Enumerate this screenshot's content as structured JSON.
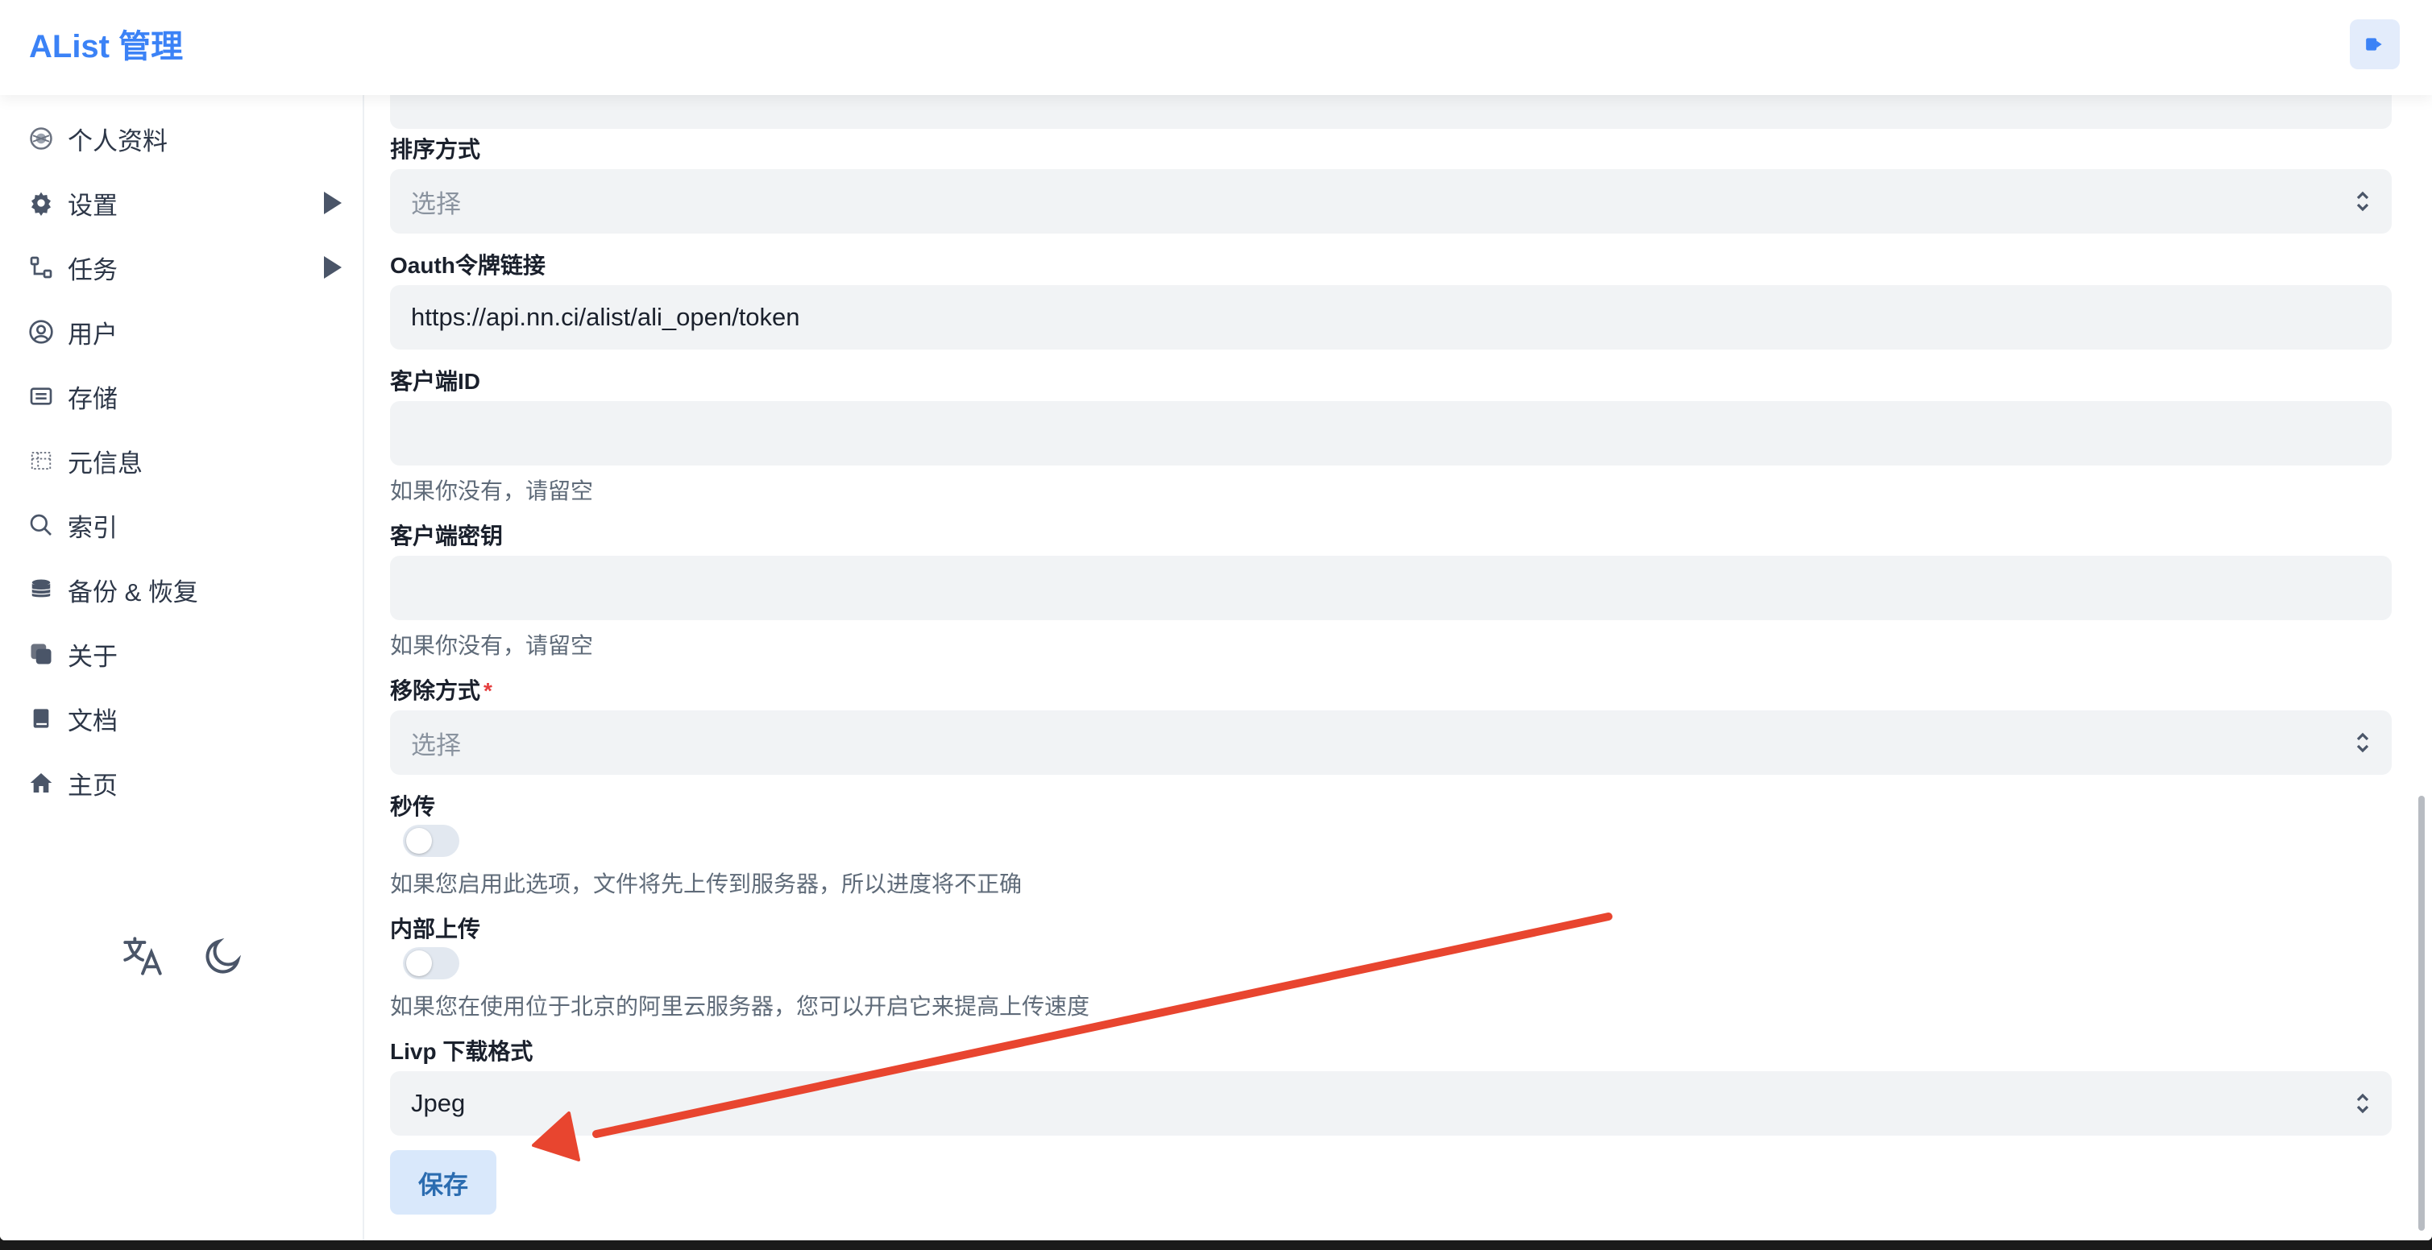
{
  "header": {
    "title": "AList 管理",
    "logout_icon": "logout-icon"
  },
  "sidebar": {
    "items": [
      {
        "label": "个人资料",
        "icon": "profile-icon"
      },
      {
        "label": "设置",
        "icon": "gear-icon",
        "expandable": true
      },
      {
        "label": "任务",
        "icon": "task-icon",
        "expandable": true
      },
      {
        "label": "用户",
        "icon": "user-icon"
      },
      {
        "label": "存储",
        "icon": "storage-icon"
      },
      {
        "label": "元信息",
        "icon": "meta-icon"
      },
      {
        "label": "索引",
        "icon": "search-icon"
      },
      {
        "label": "备份 & 恢复",
        "icon": "database-icon"
      },
      {
        "label": "关于",
        "icon": "about-icon"
      },
      {
        "label": "文档",
        "icon": "book-icon"
      },
      {
        "label": "主页",
        "icon": "home-icon"
      }
    ],
    "utilities": [
      "translate-icon",
      "moon-icon"
    ]
  },
  "form": {
    "order_direction": {
      "label": "排序方式",
      "placeholder": "选择"
    },
    "oauth_token_url": {
      "label": "Oauth令牌链接",
      "value": "https://api.nn.ci/alist/ali_open/token"
    },
    "client_id": {
      "label": "客户端ID",
      "value": "",
      "help": "如果你没有，请留空"
    },
    "client_secret": {
      "label": "客户端密钥",
      "value": "",
      "help": "如果你没有，请留空"
    },
    "remove_way": {
      "label": "移除方式",
      "required_mark": "*",
      "placeholder": "选择"
    },
    "rapid_upload": {
      "label": "秒传",
      "enabled": false,
      "help": "如果您启用此选项，文件将先上传到服务器，所以进度将不正确"
    },
    "internal_upload": {
      "label": "内部上传",
      "enabled": false,
      "help": "如果您在使用位于北京的阿里云服务器，您可以开启它来提高上传速度"
    },
    "livp_format": {
      "label": "Livp 下载格式",
      "value": "Jpeg"
    },
    "save_label": "保存"
  },
  "colors": {
    "brand": "#3b82f6",
    "annotation_arrow": "#e8452f",
    "save_bg": "#d9e8fb"
  }
}
